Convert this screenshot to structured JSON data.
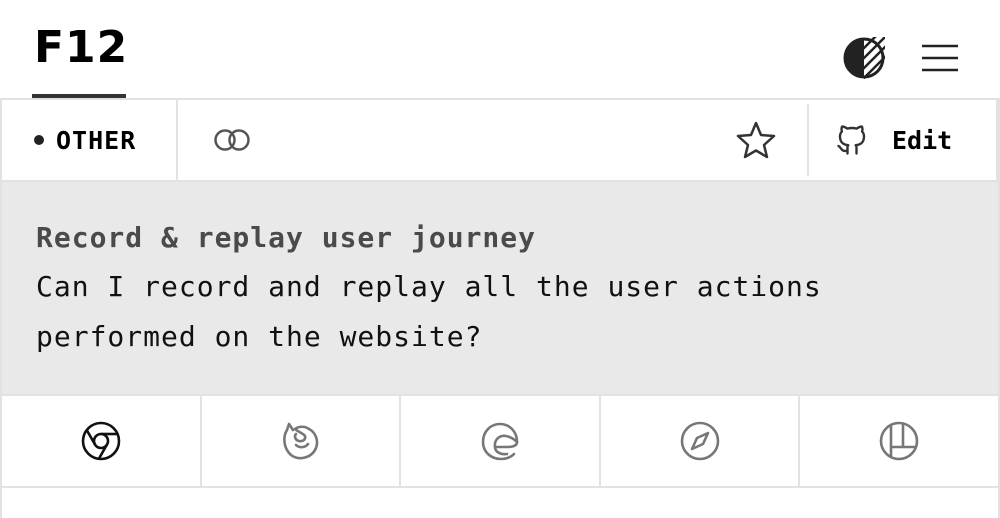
{
  "header": {
    "logo": "F12",
    "theme_icon": "contrast-icon",
    "menu_icon": "hamburger-menu-icon"
  },
  "infobar": {
    "category": "OTHER",
    "link_icon": "link-icon",
    "star_icon": "star-icon",
    "edit_label": "Edit",
    "edit_icon": "github-icon"
  },
  "question": {
    "title": "Record & replay user journey",
    "description": "Can I record and replay all the user actions performed on the website?"
  },
  "browsers": [
    {
      "name": "chrome",
      "icon": "chrome-icon",
      "active": true
    },
    {
      "name": "firefox",
      "icon": "firefox-icon",
      "active": false
    },
    {
      "name": "edge",
      "icon": "edge-icon",
      "active": false
    },
    {
      "name": "safari",
      "icon": "safari-icon",
      "active": false
    },
    {
      "name": "polypane",
      "icon": "polypane-icon",
      "active": false
    }
  ],
  "colors": {
    "content_bg": "#e9e9e9",
    "border": "#e2e2e2",
    "inactive_icon": "#777777"
  }
}
